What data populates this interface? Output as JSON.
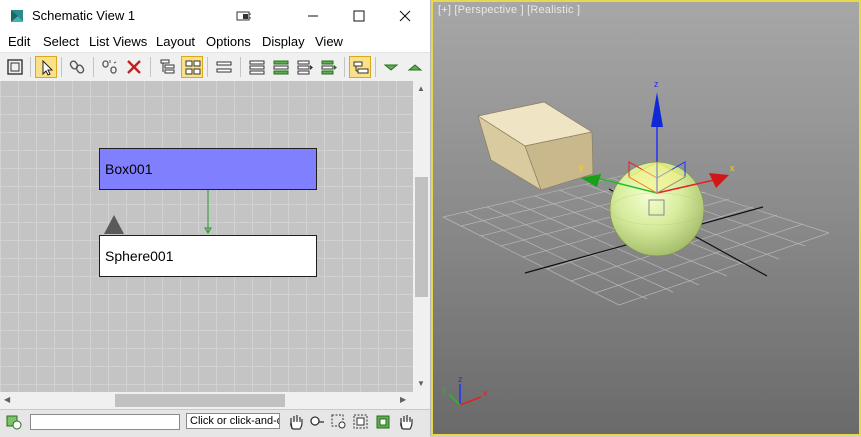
{
  "window": {
    "title": "Schematic View 1",
    "controls": [
      "restore-to-viewport",
      "minimize",
      "maximize",
      "close"
    ]
  },
  "menu": [
    "Edit",
    "Select",
    "List Views",
    "Layout",
    "Options",
    "Display",
    "View"
  ],
  "toolbar": {
    "tools": [
      "display-floater-icon",
      "select-icon",
      "connect-icon",
      "unlink-selected-icon",
      "delete-objects-icon",
      "hierarchy-mode-icon",
      "references-mode-icon",
      "always-arrange-icon",
      "arrange-children-icon",
      "arrange-selected-icon",
      "free-all-icon",
      "free-selected-icon",
      "toggle-hierarchy-icon",
      "shrink-selected-icon",
      "expand-selected-icon"
    ],
    "active_color": "#fbe08a"
  },
  "schematic": {
    "nodes": [
      {
        "label": "Box001",
        "state": "selected",
        "color": "#8080ff"
      },
      {
        "label": "Sphere001",
        "state": "normal",
        "color": "#ffffff"
      }
    ],
    "link_color": "#2a9a2a"
  },
  "statusbar": {
    "prompt": "Click or click-and-drag to select objects"
  },
  "viewport": {
    "label": "[+] [Perspective ] [Realistic ]",
    "border_color": "#e8d84a",
    "gizmo_axes": {
      "x": "x",
      "y": "y",
      "z": "z"
    },
    "triad_axes": {
      "x": "x",
      "y": "y",
      "z": "z"
    }
  }
}
